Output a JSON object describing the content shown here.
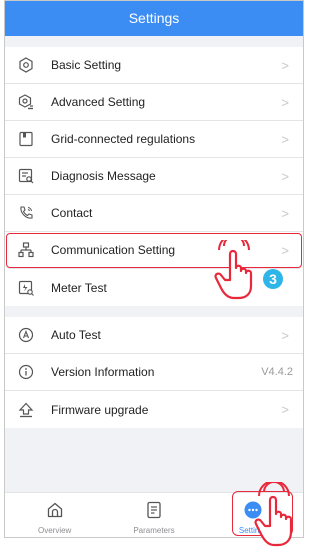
{
  "header": {
    "title": "Settings"
  },
  "colors": {
    "primary": "#3b8df4",
    "highlight": "#e8293b",
    "badge": "#2fb6e9"
  },
  "groups": [
    [
      {
        "label": "Basic Setting",
        "icon": "gear-icon",
        "trailing": ">"
      },
      {
        "label": "Advanced Setting",
        "icon": "gear-user-icon",
        "trailing": ">"
      },
      {
        "label": "Grid-connected regulations",
        "icon": "book-icon",
        "trailing": ">"
      },
      {
        "label": "Diagnosis Message",
        "icon": "diagnosis-icon",
        "trailing": ">"
      },
      {
        "label": "Contact",
        "icon": "phone-icon",
        "trailing": ">"
      },
      {
        "label": "Communication Setting",
        "icon": "network-icon",
        "trailing": ">"
      },
      {
        "label": "Meter Test",
        "icon": "meter-icon",
        "trailing": ""
      }
    ],
    [
      {
        "label": "Auto Test",
        "icon": "auto-test-icon",
        "trailing": ">"
      },
      {
        "label": "Version Information",
        "icon": "info-icon",
        "trailing": "V4.4.2"
      },
      {
        "label": "Firmware upgrade",
        "icon": "upgrade-icon",
        "trailing": ">"
      }
    ]
  ],
  "tabs": [
    {
      "label": "Overview",
      "icon": "home-icon"
    },
    {
      "label": "Parameters",
      "icon": "document-icon"
    },
    {
      "label": "Settings",
      "icon": "more-icon"
    }
  ],
  "annotation": {
    "step_number": "3"
  }
}
